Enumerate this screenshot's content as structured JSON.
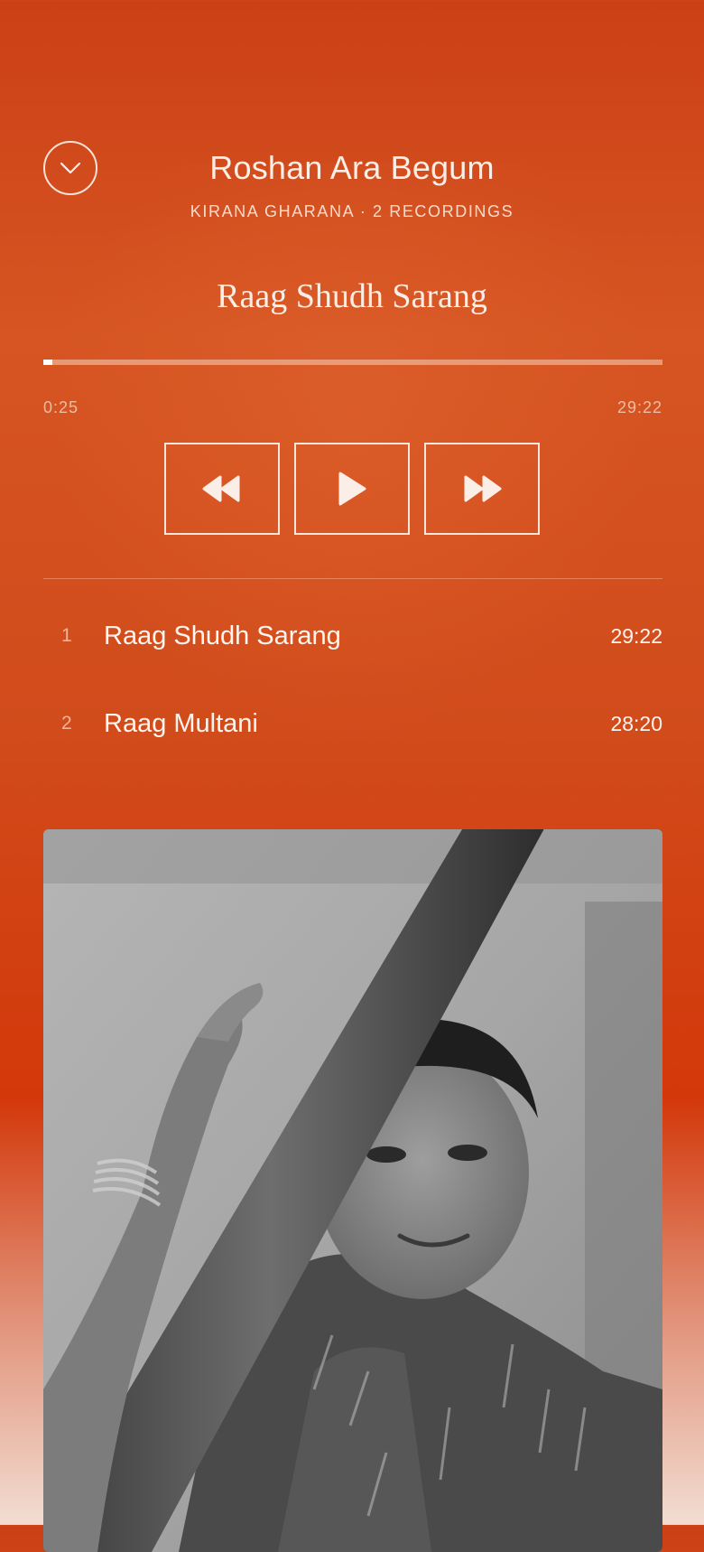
{
  "header": {
    "collapse_icon": "chevron-down-icon",
    "artist": "Roshan Ara Begum",
    "subtitle": "KIRANA GHARANA · 2 RECORDINGS"
  },
  "now_playing": {
    "title": "Raag Shudh Sarang",
    "elapsed": "0:25",
    "total": "29:22",
    "progress_fraction": 0.014
  },
  "controls": [
    {
      "name": "rewind-button",
      "icon": "rewind-icon"
    },
    {
      "name": "play-button",
      "icon": "play-icon"
    },
    {
      "name": "fast-forward-button",
      "icon": "fast-forward-icon"
    }
  ],
  "tracks": [
    {
      "number": "1",
      "title": "Raag Shudh Sarang",
      "duration": "29:22"
    },
    {
      "number": "2",
      "title": "Raag Multani",
      "duration": "28:20"
    }
  ],
  "colors": {
    "accent": "#d14b1b",
    "text": "#ffffff"
  }
}
